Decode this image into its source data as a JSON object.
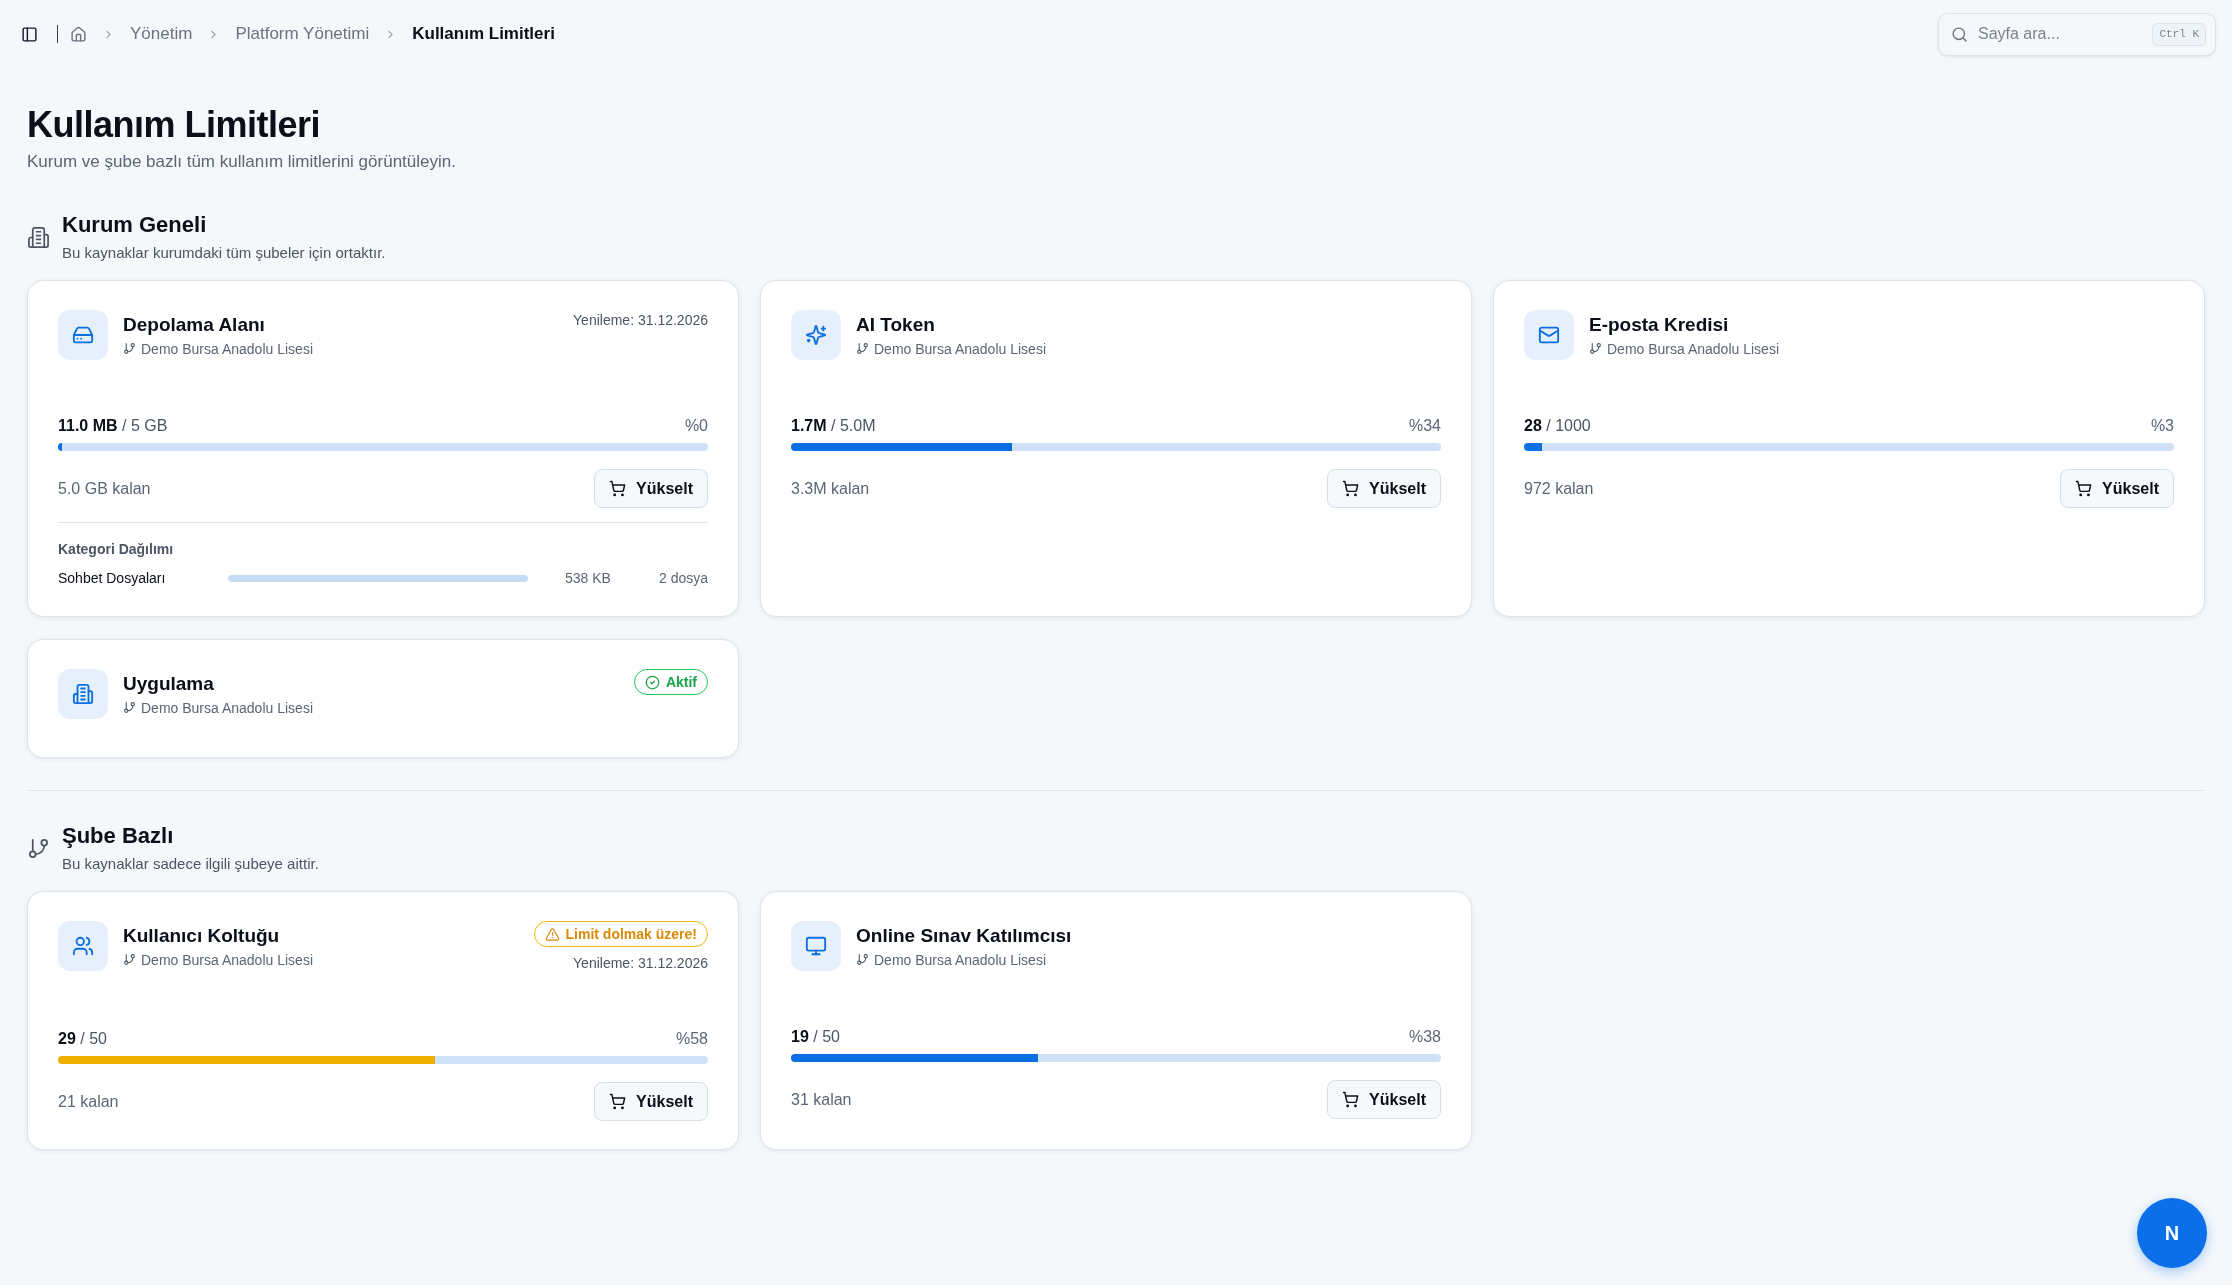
{
  "topbar": {
    "breadcrumbs": [
      {
        "label": "Yönetim",
        "current": false
      },
      {
        "label": "Platform Yönetimi",
        "current": false
      },
      {
        "label": "Kullanım Limitleri",
        "current": true
      }
    ],
    "search": {
      "placeholder": "Sayfa ara...",
      "shortcut": "Ctrl K"
    }
  },
  "page": {
    "title": "Kullanım Limitleri",
    "subtitle": "Kurum ve şube bazlı tüm kullanım limitlerini görüntüleyin."
  },
  "sections": [
    {
      "kind": "organization",
      "title": "Kurum Geneli",
      "subtitle": "Bu kaynaklar kurumdaki tüm şubeler için ortaktır.",
      "cards": [
        {
          "kind": "storage",
          "title": "Depolama Alanı",
          "branch": "Demo Bursa Anadolu Lisesi",
          "renewal": "Yenileme: 31.12.2026",
          "usage": {
            "text": "**11.0 MB** / 5 GB",
            "percent": "%0",
            "level": 0.002,
            "color": "#0b6fe3",
            "remaining": "5.0 GB kalan",
            "button": "Yükselt"
          },
          "categories": {
            "title": "Kategori Dağılımı",
            "items": [
              {
                "name": "Sohbet Dosyaları",
                "level": 1,
                "size": "538 KB",
                "files": "2 dosya"
              }
            ]
          }
        },
        {
          "kind": "ai",
          "title": "AI Token",
          "branch": "Demo Bursa Anadolu Lisesi",
          "usage": {
            "text": "**1.7M** / 5.0M",
            "percent": "%34",
            "level": 0.34,
            "color": "#0b6fe3",
            "remaining": "3.3M kalan",
            "button": "Yükselt"
          }
        },
        {
          "kind": "email",
          "title": "E-posta Kredisi",
          "branch": "Demo Bursa Anadolu Lisesi",
          "usage": {
            "text": "**28** / 1000",
            "percent": "%3",
            "level": 0.028,
            "color": "#0b6fe3",
            "remaining": "972 kalan",
            "button": "Yükselt"
          }
        },
        {
          "kind": "app",
          "title": "Uygulama",
          "branch": "Demo Bursa Anadolu Lisesi",
          "badge": {
            "kind": "success",
            "text": "Aktif"
          }
        }
      ]
    },
    {
      "kind": "branch",
      "title": "Şube Bazlı",
      "subtitle": "Bu kaynaklar sadece ilgili şubeye aittir.",
      "cards": [
        {
          "kind": "seats",
          "title": "Kullanıcı Koltuğu",
          "branch": "Demo Bursa Anadolu Lisesi",
          "badge": {
            "kind": "warning",
            "text": "Limit dolmak üzere!"
          },
          "renewal": "Yenileme: 31.12.2026",
          "usage": {
            "text": "**29** / 50",
            "percent": "%58",
            "level": 0.58,
            "color": "#efb100",
            "remaining": "21 kalan",
            "button": "Yükselt"
          }
        },
        {
          "kind": "exam",
          "title": "Online Sınav Katılımcısı",
          "branch": "Demo Bursa Anadolu Lisesi",
          "usage": {
            "text": "**19** / 50",
            "percent": "%38",
            "level": 0.38,
            "color": "#0b6fe3",
            "remaining": "31 kalan",
            "button": "Yükselt"
          }
        }
      ]
    }
  ],
  "fab": {
    "label": "N"
  }
}
